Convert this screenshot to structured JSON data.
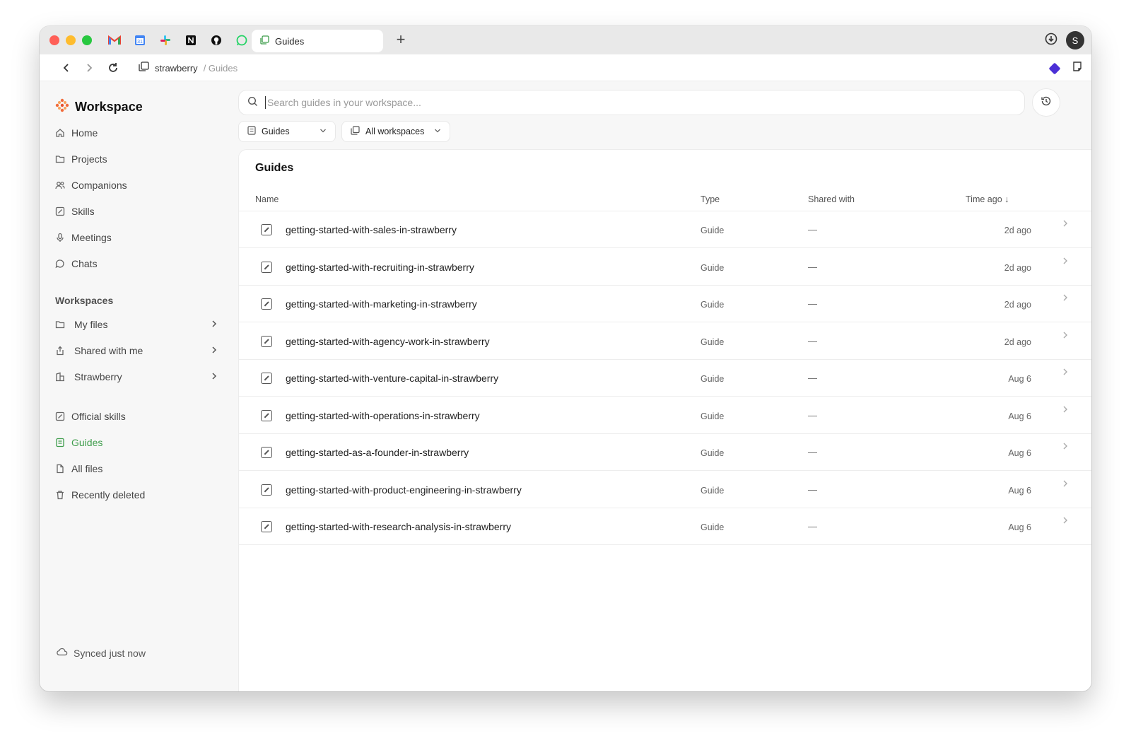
{
  "browser": {
    "active_tab_label": "Guides",
    "new_tab_label": "+",
    "avatar_letter": "S",
    "url_workspace": "strawberry",
    "url_path": "/ Guides"
  },
  "sidebar": {
    "brand": "Workspace",
    "nav": [
      {
        "label": "Home",
        "icon": "home-icon"
      },
      {
        "label": "Projects",
        "icon": "folder-icon"
      },
      {
        "label": "Companions",
        "icon": "people-icon"
      },
      {
        "label": "Skills",
        "icon": "skill-icon"
      },
      {
        "label": "Meetings",
        "icon": "microphone-icon"
      },
      {
        "label": "Chats",
        "icon": "chat-icon"
      }
    ],
    "workspaces_heading": "Workspaces",
    "workspaces": [
      {
        "label": "My files",
        "icon": "folder-icon"
      },
      {
        "label": "Shared with me",
        "icon": "share-icon"
      },
      {
        "label": "Strawberry",
        "icon": "building-icon"
      }
    ],
    "bottom_nav": [
      {
        "label": "Official skills",
        "icon": "skill-icon"
      },
      {
        "label": "Guides",
        "icon": "guide-icon"
      },
      {
        "label": "All files",
        "icon": "file-icon"
      },
      {
        "label": "Recently deleted",
        "icon": "trash-icon"
      }
    ],
    "synced_text": "Synced just now",
    "accent_color": "#3f9d4c"
  },
  "main": {
    "search_placeholder": "Search guides in your workspace...",
    "filter_type": "Guides",
    "filter_workspace": "All workspaces",
    "panel_title": "Guides",
    "columns": {
      "name": "Name",
      "type": "Type",
      "shared": "Shared with",
      "time": "Time ago ↓"
    },
    "rows": [
      {
        "name": "getting-started-with-sales-in-strawberry",
        "type": "Guide",
        "shared": "—",
        "time": "2d ago"
      },
      {
        "name": "getting-started-with-recruiting-in-strawberry",
        "type": "Guide",
        "shared": "—",
        "time": "2d ago"
      },
      {
        "name": "getting-started-with-marketing-in-strawberry",
        "type": "Guide",
        "shared": "—",
        "time": "2d ago"
      },
      {
        "name": "getting-started-with-agency-work-in-strawberry",
        "type": "Guide",
        "shared": "—",
        "time": "2d ago"
      },
      {
        "name": "getting-started-with-venture-capital-in-strawberry",
        "type": "Guide",
        "shared": "—",
        "time": "Aug 6"
      },
      {
        "name": "getting-started-with-operations-in-strawberry",
        "type": "Guide",
        "shared": "—",
        "time": "Aug 6"
      },
      {
        "name": "getting-started-as-a-founder-in-strawberry",
        "type": "Guide",
        "shared": "—",
        "time": "Aug 6"
      },
      {
        "name": "getting-started-with-product-engineering-in-strawberry",
        "type": "Guide",
        "shared": "—",
        "time": "Aug 6"
      },
      {
        "name": "getting-started-with-research-analysis-in-strawberry",
        "type": "Guide",
        "shared": "—",
        "time": "Aug 6"
      }
    ]
  }
}
